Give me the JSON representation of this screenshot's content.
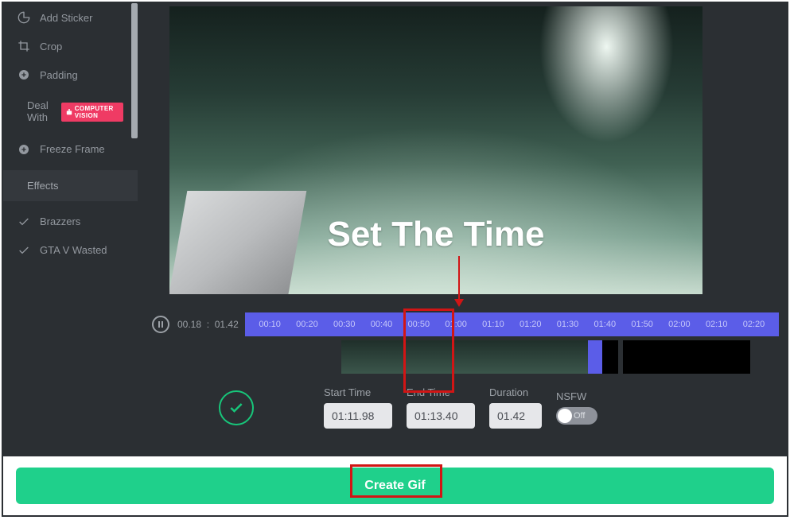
{
  "sidebar": {
    "items": [
      {
        "label": "Add Sticker"
      },
      {
        "label": "Crop"
      },
      {
        "label": "Padding"
      },
      {
        "deal": "Deal",
        "with": "With",
        "badge": "COMPUTER VISION"
      },
      {
        "label": "Freeze Frame"
      }
    ],
    "effects_header": "Effects",
    "effects": [
      {
        "label": "Brazzers"
      },
      {
        "label": "GTA V Wasted"
      }
    ]
  },
  "annotation": {
    "title": "Set The Time"
  },
  "timeline": {
    "current": "00.18",
    "sep": ":",
    "total": "01.42",
    "ticks": [
      "00:10",
      "00:20",
      "00:30",
      "00:40",
      "00:50",
      "01:00",
      "01:10",
      "01:20",
      "01:30",
      "01:40",
      "01:50",
      "02:00",
      "02:10",
      "02:20"
    ]
  },
  "controls": {
    "start_label": "Start Time",
    "start_value": "01:11.98",
    "end_label": "End Time",
    "end_value": "01:13.40",
    "duration_label": "Duration",
    "duration_value": "01.42",
    "nsfw_label": "NSFW",
    "nsfw_state": "Off"
  },
  "create_label": "Create Gif"
}
